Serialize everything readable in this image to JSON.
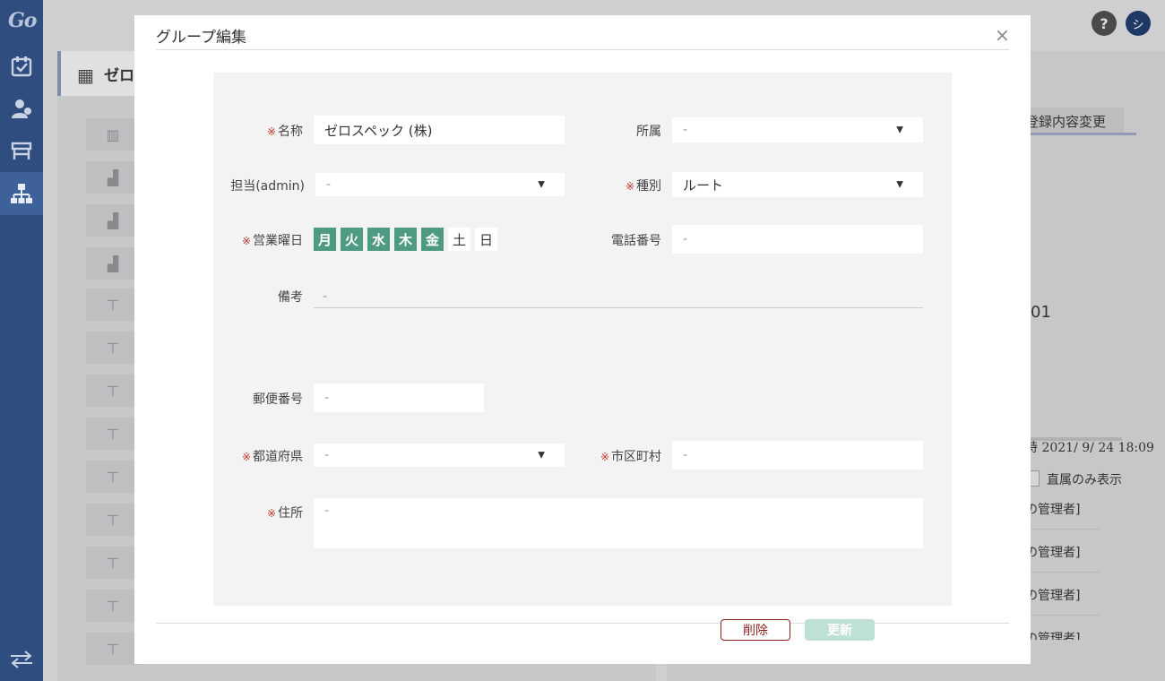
{
  "app": {
    "logo": "Go"
  },
  "topbar": {
    "help": "?",
    "avatar": "シ"
  },
  "background": {
    "header_title": "ゼロ",
    "register_button": "登録内容変更",
    "code_fragment": "01",
    "timestamp": "時 2021/ 9/ 24 18:09",
    "direct_only": "直属のみ表示",
    "role_rows": [
      "の管理者]",
      "の管理者]",
      "の管理者]",
      "の管理者]"
    ]
  },
  "modal": {
    "title": "グループ編集",
    "close_symbol": "×",
    "required_mark": "※",
    "fields": {
      "name": {
        "label": "名称",
        "value": "ゼロスペック (株)"
      },
      "affiliation": {
        "label": "所属",
        "value": "-"
      },
      "admin": {
        "label": "担当(admin)",
        "value": "-"
      },
      "kind": {
        "label": "種別",
        "value": "ルート"
      },
      "business_days": {
        "label": "営業曜日"
      },
      "phone": {
        "label": "電話番号",
        "value": "-"
      },
      "remarks": {
        "label": "備考",
        "value": "-"
      },
      "postal": {
        "label": "郵便番号",
        "value": "-"
      },
      "prefecture": {
        "label": "都道府県",
        "value": "-"
      },
      "city": {
        "label": "市区町村",
        "value": "-"
      },
      "address": {
        "label": "住所",
        "value": "-"
      }
    },
    "days": [
      {
        "label": "月",
        "on": true
      },
      {
        "label": "火",
        "on": true
      },
      {
        "label": "水",
        "on": true
      },
      {
        "label": "木",
        "on": true
      },
      {
        "label": "金",
        "on": true
      },
      {
        "label": "土",
        "on": false
      },
      {
        "label": "日",
        "on": false
      }
    ],
    "buttons": {
      "delete": "削除",
      "update": "更新"
    }
  },
  "colors": {
    "sidebar": "#2f4d7e",
    "day_active": "#4e9a82",
    "delete": "#8b1e1e",
    "update_disabled": "#bfe0d7",
    "required": "#c0392b"
  }
}
